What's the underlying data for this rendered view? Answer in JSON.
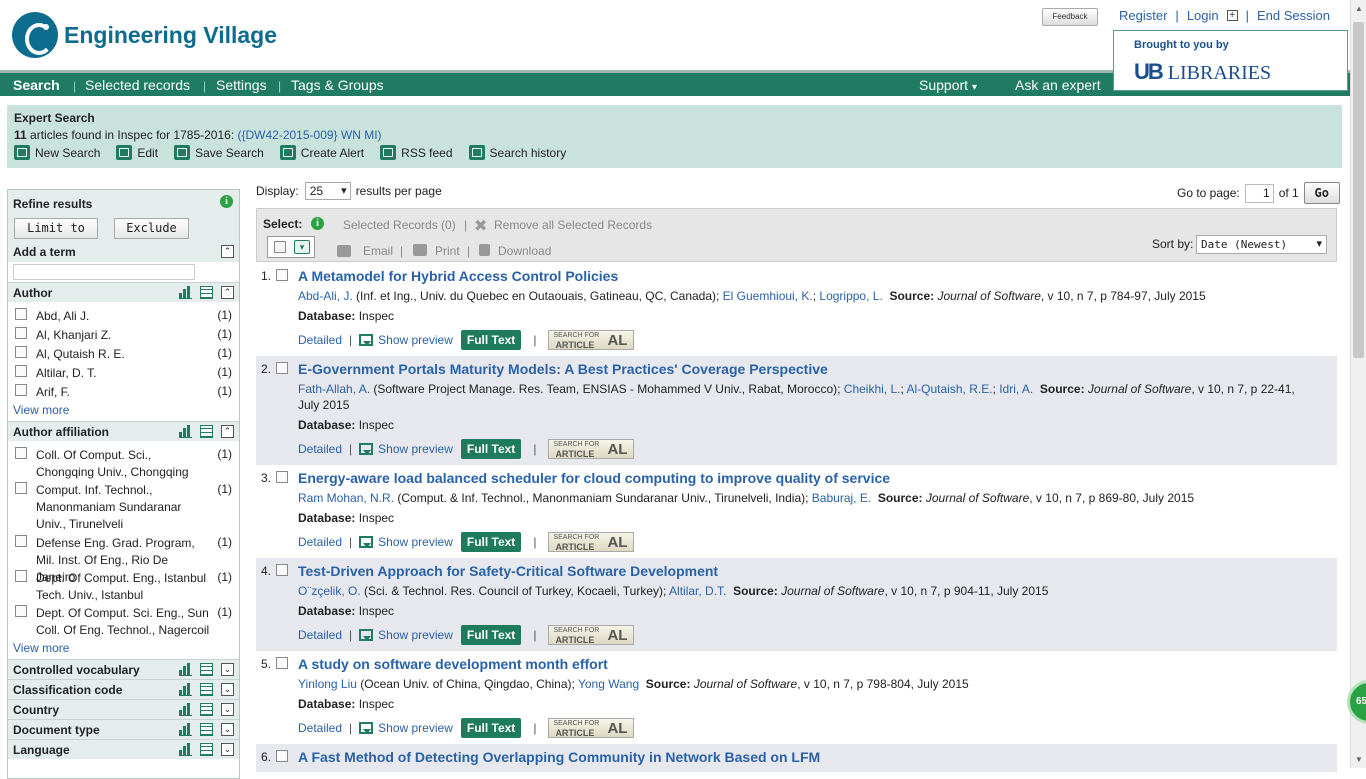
{
  "header": {
    "brand": "Engineering Village",
    "feedback": "Feedback",
    "register": "Register",
    "login": "Login",
    "end_session": "End Session",
    "brought_by": "Brought to you by",
    "library_mark": "UB",
    "library_name": "LIBRARIES"
  },
  "nav": {
    "search": "Search",
    "selected_records": "Selected records",
    "settings": "Settings",
    "tags_groups": "Tags & Groups",
    "support": "Support",
    "ask_expert": "Ask an expert"
  },
  "search_summary": {
    "title": "Expert Search",
    "count": "11",
    "text": " articles found in Inspec for 1785-2016: ",
    "query": "({DW42-2015-009} WN MI)",
    "actions": [
      "New Search",
      "Edit",
      "Save Search",
      "Create Alert",
      "RSS feed",
      "Search history"
    ]
  },
  "refine": {
    "title": "Refine results",
    "limit_to": "Limit to",
    "exclude": "Exclude",
    "add_term": "Add a term",
    "author": {
      "title": "Author",
      "items": [
        {
          "label": "Abd, Ali J.",
          "count": "(1)"
        },
        {
          "label": "Al, Khanjari Z.",
          "count": "(1)"
        },
        {
          "label": "Al, Qutaish R. E.",
          "count": "(1)"
        },
        {
          "label": "Altilar, D. T.",
          "count": "(1)"
        },
        {
          "label": "Arif, F.",
          "count": "(1)"
        }
      ],
      "view_more": "View more"
    },
    "affiliation": {
      "title": "Author affiliation",
      "items": [
        {
          "label": "Coll. Of Comput. Sci., Chongqing Univ., Chongqing",
          "count": "(1)"
        },
        {
          "label": "Comput. Inf. Technol., Manonmaniam Sundaranar Univ., Tirunelveli",
          "count": "(1)"
        },
        {
          "label": "Defense Eng. Grad. Program, Mil. Inst. Of Eng., Rio De Janeiro",
          "count": "(1)"
        },
        {
          "label": "Dept. Of Comput. Eng., Istanbul Tech. Univ., Istanbul",
          "count": "(1)"
        },
        {
          "label": "Dept. Of Comput. Sci. Eng., Sun Coll. Of Eng. Technol., Nagercoil",
          "count": "(1)"
        }
      ],
      "view_more": "View more"
    },
    "collapsed": [
      "Controlled vocabulary",
      "Classification code",
      "Country",
      "Document type",
      "Language"
    ]
  },
  "results_controls": {
    "display_label": "Display:",
    "per_page": "25",
    "per_page_suffix": "results per page",
    "goto_label": "Go to page:",
    "page": "1",
    "of_label": "of 1",
    "go": "Go",
    "select_label": "Select:",
    "selected_records": "Selected Records (0)",
    "remove_all": "Remove all Selected Records",
    "email": "Email",
    "print": "Print",
    "download": "Download",
    "sort_label": "Sort by:",
    "sort_value": "Date (Newest)"
  },
  "results": [
    {
      "num": "1.",
      "title": "A Metamodel for Hybrid Access Control Policies",
      "first_author": "Abd-Ali, J.",
      "affiliation": " (Inf. et Ing., Univ. du Quebec en Outaouais, Gatineau, QC, Canada); ",
      "other_authors": [
        "El Guemhioui, K.",
        "Logrippo, L."
      ],
      "source_journal": "Journal of Software",
      "source_rest": ", v 10, n 7, p 784-97, July 2015",
      "database": "Inspec"
    },
    {
      "num": "2.",
      "title": "E-Government Portals Maturity Models: A Best Practices' Coverage Perspective",
      "first_author": "Fath-Allah, A.",
      "affiliation": " (Software Project Manage. Res. Team, ENSIAS - Mohammed V Univ., Rabat, Morocco); ",
      "other_authors": [
        "Cheikhi, L.",
        "Al-Qutaish, R.E.",
        "Idri, A."
      ],
      "source_journal": "Journal of Software",
      "source_rest": ", v 10, n 7, p 22-41, July 2015",
      "database": "Inspec"
    },
    {
      "num": "3.",
      "title": "Energy-aware load balanced scheduler for cloud computing to improve quality of service",
      "first_author": "Ram Mohan, N.R.",
      "affiliation": " (Comput. & Inf. Technol., Manonmaniam Sundaranar Univ., Tirunelveli, India); ",
      "other_authors": [
        "Baburaj, E."
      ],
      "source_journal": "Journal of Software",
      "source_rest": ", v 10, n 7, p 869-80, July 2015",
      "database": "Inspec"
    },
    {
      "num": "4.",
      "title": "Test-Driven Approach for Safety-Critical Software Development",
      "first_author": "O¨zçelik, O.",
      "affiliation": " (Sci. & Technol. Res. Council of Turkey, Kocaeli, Turkey); ",
      "other_authors": [
        "Altilar, D.T."
      ],
      "source_journal": "Journal of Software",
      "source_rest": ", v 10, n 7, p 904-11, July 2015",
      "database": "Inspec"
    },
    {
      "num": "5.",
      "title": "A study on software development month effort",
      "first_author": "Yinlong Liu",
      "affiliation": " (Ocean Univ. of China, Qingdao, China); ",
      "other_authors": [
        "Yong Wang"
      ],
      "source_journal": "Journal of Software",
      "source_rest": ", v 10, n 7, p 798-804, July 2015",
      "database": "Inspec"
    },
    {
      "num": "6.",
      "title": "A Fast Method of Detecting Overlapping Community in Network Based on LFM",
      "first_author": "",
      "affiliation": "",
      "other_authors": [],
      "source_journal": "",
      "source_rest": "",
      "database": ""
    }
  ],
  "result_links": {
    "detailed": "Detailed",
    "preview": "Show preview",
    "full_text": "Full Text",
    "sfa_top": "SEARCH FOR",
    "sfa_bottom": "ARTICLE",
    "sfa_logo": "AL",
    "source_label": "Source:",
    "database_label": "Database:"
  },
  "badge": "65",
  "colors": {
    "nav": "#1f7c63",
    "summary_bg": "#c9e3dc",
    "link": "#2962a8",
    "full_text": "#1e7b5b"
  }
}
